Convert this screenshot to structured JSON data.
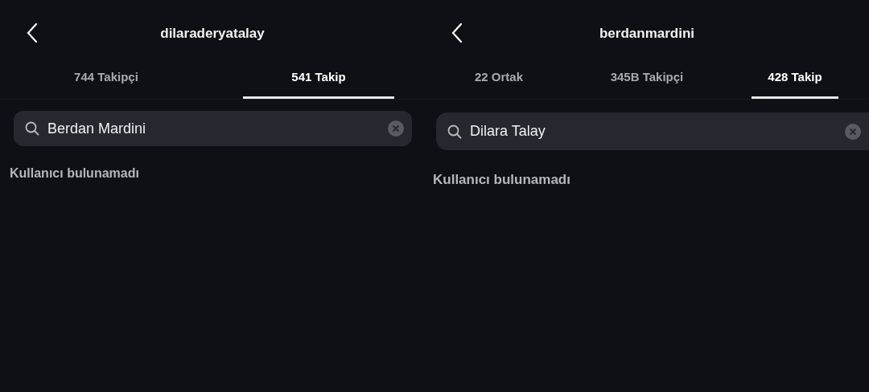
{
  "panels": [
    {
      "title": "dilaraderyatalay",
      "tabs": [
        {
          "label": "744 Takipçi",
          "selected": false
        },
        {
          "label": "541 Takip",
          "selected": true
        }
      ],
      "search": {
        "value": "Berdan Mardini"
      },
      "message": "Kullanıcı bulunamadı"
    },
    {
      "title": "berdanmardini",
      "tabs": [
        {
          "label": "22 Ortak",
          "selected": false
        },
        {
          "label": "345B Takipçi",
          "selected": false
        },
        {
          "label": "428 Takip",
          "selected": true
        }
      ],
      "search": {
        "value": "Dilara Talay"
      },
      "message": "Kullanıcı bulunamadı"
    }
  ]
}
